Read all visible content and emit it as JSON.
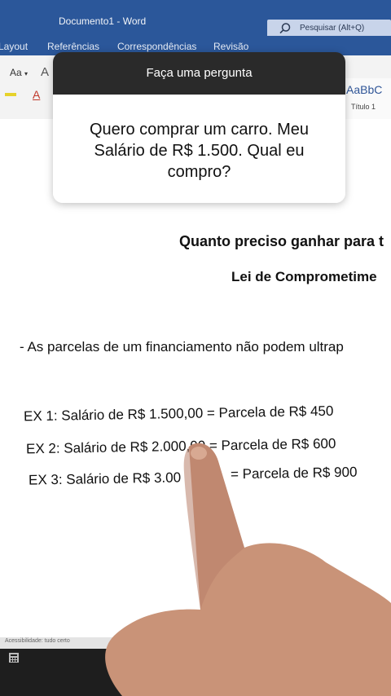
{
  "window": {
    "title": "Documento1  -  Word",
    "search_placeholder": "Pesquisar (Alt+Q)"
  },
  "ribbon": {
    "tabs": [
      "Layout",
      "Referências",
      "Correspondências",
      "Revisão"
    ],
    "font_size_label": "Aa",
    "style_sample": "AaBbC",
    "style_name": "Título 1"
  },
  "question_card": {
    "header": "Faça uma pergunta",
    "text": "Quero comprar um carro. Meu Salário de R$ 1.500. Qual eu compro?"
  },
  "document": {
    "heading1": "Quanto preciso ganhar para t",
    "heading2": "Lei de Comprometime",
    "bullet": "- As parcelas de um financiamento não podem ultrap",
    "ex1": "EX 1: Salário de R$ 1.500,00 = Parcela de R$ 450",
    "ex2": "EX 2: Salário de R$ 2.000,00 = Parcela de R$ 600",
    "ex3_left": "EX 3: Salário de R$ 3.00",
    "ex3_right": "= Parcela de R$ 900"
  },
  "statusbar": {
    "accessibility": "Acessibilidade: tudo certo"
  },
  "colors": {
    "word_blue": "#2b579a",
    "card_header": "#2a2a2a"
  }
}
